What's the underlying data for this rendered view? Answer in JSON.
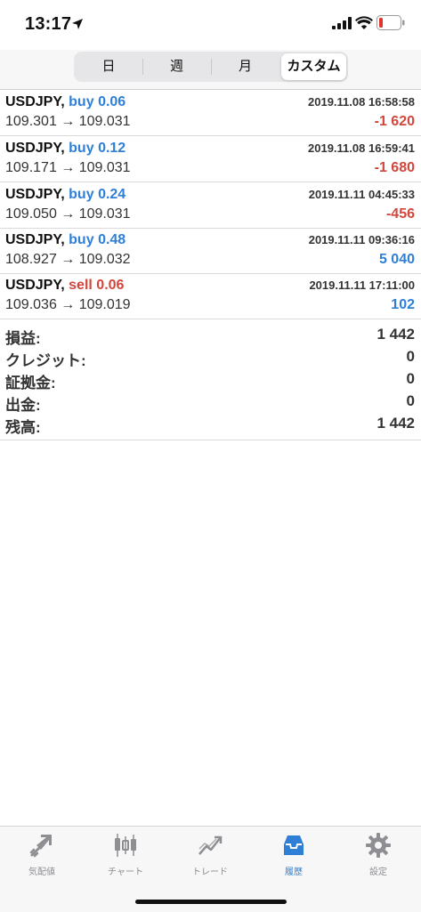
{
  "status_bar": {
    "time": "13:17"
  },
  "segments": [
    "日",
    "週",
    "月",
    "カスタム"
  ],
  "selected_segment": "カスタム",
  "trades": [
    {
      "symbol": "USDJPY,",
      "side": "buy",
      "volume": "0.06",
      "datetime": "2019.11.08 16:58:58",
      "prices": "109.301 → 109.031",
      "profit": "-1 620",
      "profit_sign": "neg"
    },
    {
      "symbol": "USDJPY,",
      "side": "buy",
      "volume": "0.12",
      "datetime": "2019.11.08 16:59:41",
      "prices": "109.171 → 109.031",
      "profit": "-1 680",
      "profit_sign": "neg"
    },
    {
      "symbol": "USDJPY,",
      "side": "buy",
      "volume": "0.24",
      "datetime": "2019.11.11 04:45:33",
      "prices": "109.050 → 109.031",
      "profit": "-456",
      "profit_sign": "neg"
    },
    {
      "symbol": "USDJPY,",
      "side": "buy",
      "volume": "0.48",
      "datetime": "2019.11.11 09:36:16",
      "prices": "108.927 → 109.032",
      "profit": "5 040",
      "profit_sign": "pos"
    },
    {
      "symbol": "USDJPY,",
      "side": "sell",
      "volume": "0.06",
      "datetime": "2019.11.11 17:11:00",
      "prices": "109.036 → 109.019",
      "profit": "102",
      "profit_sign": "pos"
    }
  ],
  "summary": [
    {
      "label": "損益:",
      "value": "1 442"
    },
    {
      "label": "クレジット:",
      "value": "0"
    },
    {
      "label": "証拠金:",
      "value": "0"
    },
    {
      "label": "出金:",
      "value": "0"
    },
    {
      "label": "残高:",
      "value": "1 442"
    }
  ],
  "tabs": [
    {
      "label": "気配値",
      "icon": "quotes-icon"
    },
    {
      "label": "チャート",
      "icon": "chart-icon"
    },
    {
      "label": "トレード",
      "icon": "trade-icon"
    },
    {
      "label": "履歴",
      "icon": "history-icon",
      "active": true
    },
    {
      "label": "設定",
      "icon": "settings-icon"
    }
  ],
  "colors": {
    "accent_blue": "#2f7fd6",
    "loss_red": "#d2463b",
    "battery_low": "#e0342b"
  }
}
